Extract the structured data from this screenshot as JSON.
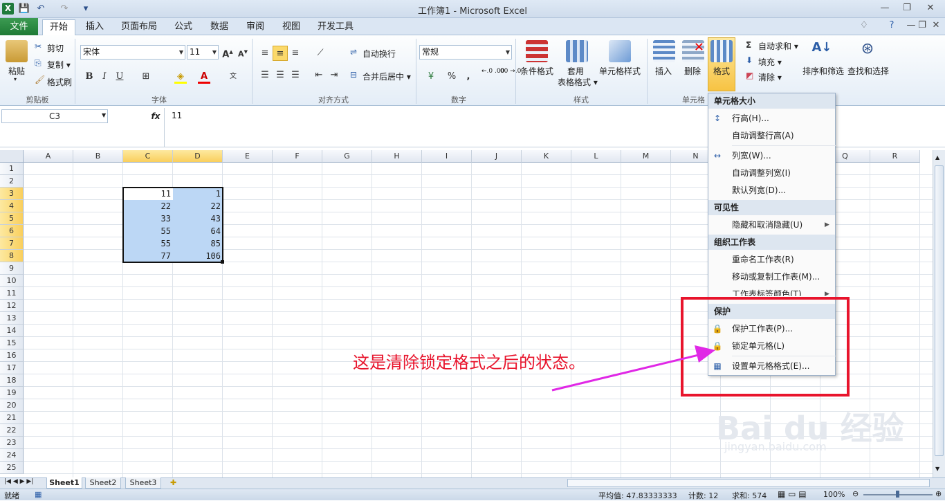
{
  "window": {
    "title": "工作簿1 - Microsoft Excel",
    "app_icon": "X"
  },
  "qat": {
    "save_icon": "💾",
    "undo_icon": "↶",
    "redo_icon": "↷",
    "customize_icon": "▾"
  },
  "tabs": {
    "file": "文件",
    "items": [
      "开始",
      "插入",
      "页面布局",
      "公式",
      "数据",
      "审阅",
      "视图",
      "开发工具"
    ],
    "active": "开始"
  },
  "ribbon": {
    "clipboard": {
      "paste": "粘贴",
      "cut": "剪切",
      "copy": "复制 ▾",
      "format_painter": "格式刷",
      "label": "剪贴板"
    },
    "font": {
      "name": "宋体",
      "size": "11",
      "bold": "B",
      "italic": "I",
      "underline": "U",
      "label": "字体"
    },
    "alignment": {
      "wrap": "自动换行",
      "merge": "合并后居中 ▾",
      "label": "对齐方式"
    },
    "number": {
      "format": "常规",
      "percent": "%",
      "comma": ",",
      "inc_dec": "←.0 .00",
      "dec_dec": ".00 →.0",
      "label": "数字"
    },
    "styles": {
      "conditional": "条件格式",
      "table_line1": "套用",
      "table_line2": "表格格式 ▾",
      "cell_styles": "单元格样式",
      "label": "样式"
    },
    "cells": {
      "insert": "插入",
      "delete": "删除",
      "format": "格式",
      "label": "单元格"
    },
    "editing": {
      "autosum": "自动求和 ▾",
      "fill": "填充 ▾",
      "clear": "清除 ▾",
      "sort": "排序和筛选",
      "find": "查找和选择"
    }
  },
  "formula_bar": {
    "name_box": "C3",
    "fx": "fx",
    "value": "11"
  },
  "grid": {
    "columns": [
      "A",
      "B",
      "C",
      "D",
      "E",
      "F",
      "G",
      "H",
      "I",
      "J",
      "K",
      "L",
      "M",
      "N",
      "O",
      "P",
      "Q",
      "R"
    ],
    "rows": [
      "1",
      "2",
      "3",
      "4",
      "5",
      "6",
      "7",
      "8",
      "9",
      "10",
      "11",
      "12",
      "13",
      "14",
      "15",
      "16",
      "17",
      "18",
      "19",
      "20",
      "21",
      "22",
      "23",
      "24",
      "25"
    ],
    "col_c": [
      "11",
      "22",
      "33",
      "55",
      "55",
      "77"
    ],
    "col_d": [
      "1",
      "22",
      "43",
      "64",
      "85",
      "106"
    ]
  },
  "sheets": [
    "Sheet1",
    "Sheet2",
    "Sheet3"
  ],
  "status": {
    "mode": "就绪",
    "average": "平均值: 47.83333333",
    "count": "计数: 12",
    "sum": "求和: 574",
    "zoom": "100%"
  },
  "menu": {
    "h1": "单元格大小",
    "row_height": "行高(H)...",
    "autofit_row": "自动调整行高(A)",
    "col_width": "列宽(W)...",
    "autofit_col": "自动调整列宽(I)",
    "default_width": "默认列宽(D)...",
    "h2": "可见性",
    "hide_unhide": "隐藏和取消隐藏(U)",
    "h3": "组织工作表",
    "rename": "重命名工作表(R)",
    "move_copy": "移动或复制工作表(M)...",
    "tab_color": "工作表标签颜色(T)",
    "h4": "保护",
    "protect_sheet": "保护工作表(P)...",
    "lock_cell": "锁定单元格(L)",
    "format_cells": "设置单元格格式(E)..."
  },
  "annotation": "这是清除锁定格式之后的状态。",
  "watermark": "Bai du 经验",
  "watermark_url": "jingyan.baidu.com"
}
